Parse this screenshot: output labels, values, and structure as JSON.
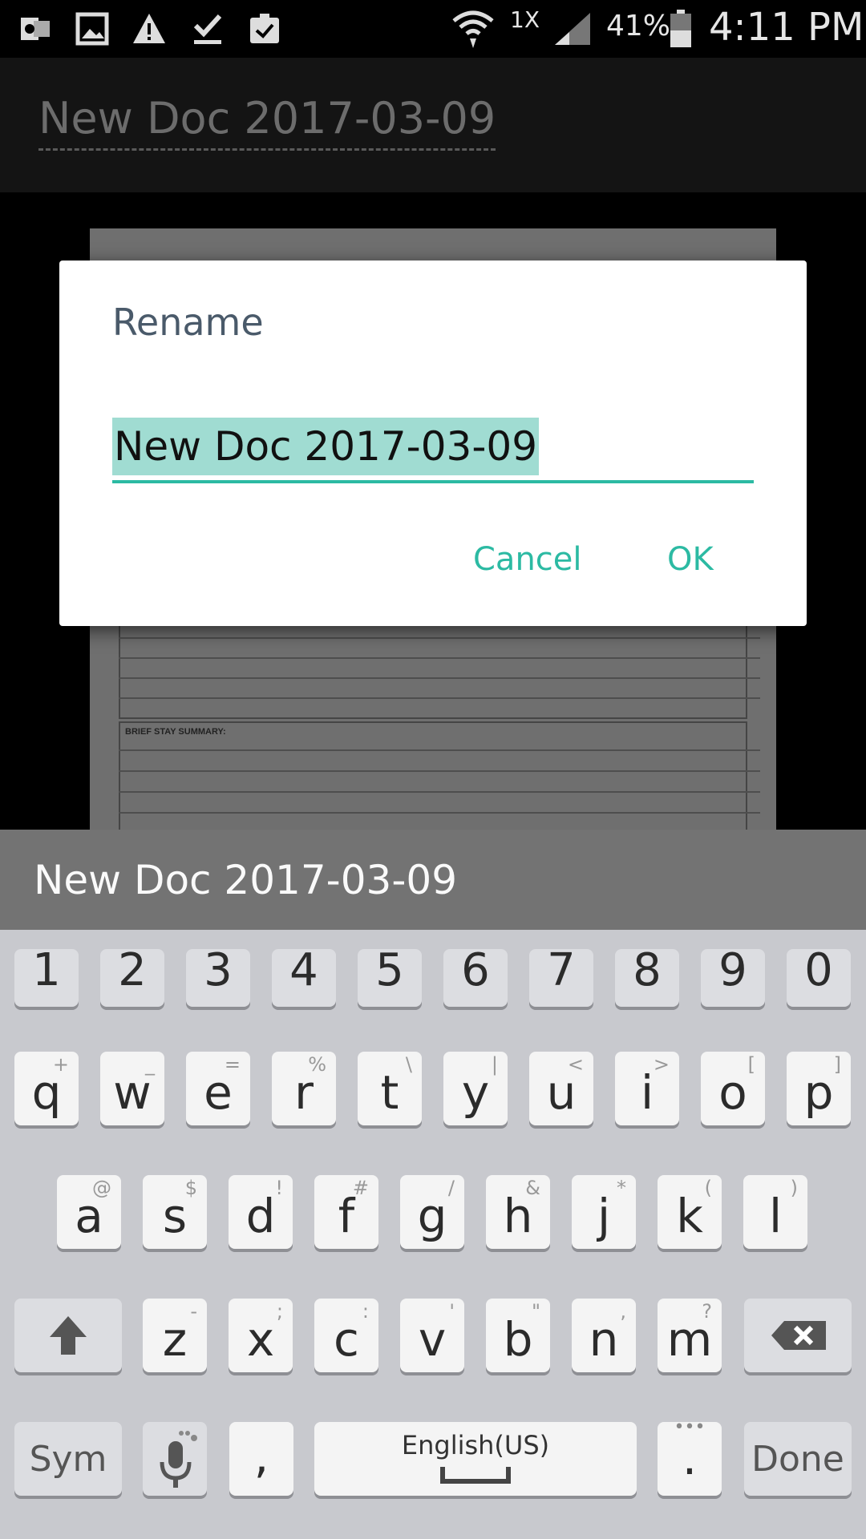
{
  "status_bar": {
    "network": "1X",
    "battery": "41%",
    "time": "4:11 PM",
    "icons": [
      "outlook-icon",
      "gallery-icon",
      "warning-icon",
      "download-done-icon",
      "clipboard-check-icon",
      "wifi-icon",
      "signal-icon",
      "battery-icon"
    ]
  },
  "toolbar": {
    "doc_title": "New Doc 2017-03-09"
  },
  "preview": {
    "section_label": "BRIEF STAY SUMMARY:"
  },
  "dialog": {
    "title": "Rename",
    "input_value": "New Doc 2017-03-09",
    "cancel_label": "Cancel",
    "ok_label": "OK",
    "accent_color": "#2cbaa3"
  },
  "suggestion": {
    "text": "New Doc 2017-03-09"
  },
  "keyboard": {
    "numbers": [
      "1",
      "2",
      "3",
      "4",
      "5",
      "6",
      "7",
      "8",
      "9",
      "0"
    ],
    "row1": [
      {
        "k": "q",
        "s": "+"
      },
      {
        "k": "w",
        "s": "_"
      },
      {
        "k": "e",
        "s": "="
      },
      {
        "k": "r",
        "s": "%"
      },
      {
        "k": "t",
        "s": "\\"
      },
      {
        "k": "y",
        "s": "|"
      },
      {
        "k": "u",
        "s": "<"
      },
      {
        "k": "i",
        "s": ">"
      },
      {
        "k": "o",
        "s": "["
      },
      {
        "k": "p",
        "s": "]"
      }
    ],
    "row2": [
      {
        "k": "a",
        "s": "@"
      },
      {
        "k": "s",
        "s": "$"
      },
      {
        "k": "d",
        "s": "!"
      },
      {
        "k": "f",
        "s": "#"
      },
      {
        "k": "g",
        "s": "/"
      },
      {
        "k": "h",
        "s": "&"
      },
      {
        "k": "j",
        "s": "*"
      },
      {
        "k": "k",
        "s": "("
      },
      {
        "k": "l",
        "s": ")"
      }
    ],
    "row3": [
      {
        "k": "z",
        "s": "-"
      },
      {
        "k": "x",
        "s": ";"
      },
      {
        "k": "c",
        "s": ":"
      },
      {
        "k": "v",
        "s": "'"
      },
      {
        "k": "b",
        "s": "\""
      },
      {
        "k": "n",
        "s": ","
      },
      {
        "k": "m",
        "s": "?"
      }
    ],
    "sym_label": "Sym",
    "comma": ",",
    "space_label": "English(US)",
    "period": ".",
    "done_label": "Done"
  }
}
